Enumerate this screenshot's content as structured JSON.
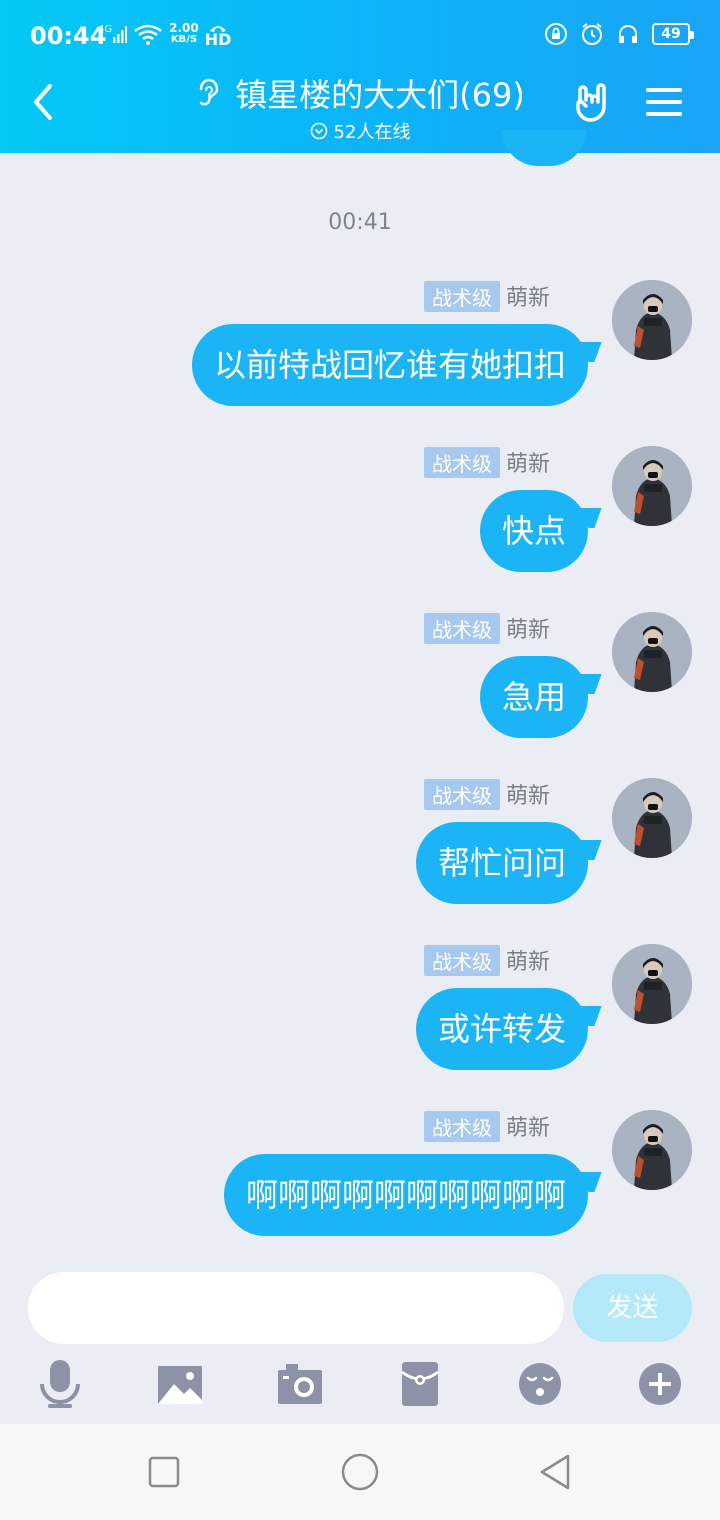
{
  "status_bar": {
    "time": "00:44",
    "network": "4G",
    "speed_value": "2.00",
    "speed_unit": "KB/S",
    "hd": "HD",
    "battery": "49"
  },
  "header": {
    "title": "镇星楼的大大们(69)",
    "online": "52人在线"
  },
  "timestamp": "00:41",
  "messages": [
    {
      "badge": "战术级",
      "nick": "萌新",
      "text": "以前特战回忆谁有她扣扣"
    },
    {
      "badge": "战术级",
      "nick": "萌新",
      "text": "快点"
    },
    {
      "badge": "战术级",
      "nick": "萌新",
      "text": "急用"
    },
    {
      "badge": "战术级",
      "nick": "萌新",
      "text": "帮忙问问"
    },
    {
      "badge": "战术级",
      "nick": "萌新",
      "text": "或许转发"
    },
    {
      "badge": "战术级",
      "nick": "萌新",
      "text": "啊啊啊啊啊啊啊啊啊啊"
    }
  ],
  "composer": {
    "placeholder": "",
    "send_label": "发送"
  },
  "toolbar_icons": [
    "microphone-icon",
    "image-icon",
    "camera-icon",
    "red-packet-icon",
    "emoji-icon",
    "plus-icon"
  ],
  "colors": {
    "bubble": "#1bb5f5",
    "header_start": "#03c9f5",
    "header_end": "#1aa4f6",
    "badge": "#a7c8ef",
    "background": "#eaedf4",
    "send_disabled": "#b5e9f9",
    "toolbar_icon": "#8d93a6"
  }
}
